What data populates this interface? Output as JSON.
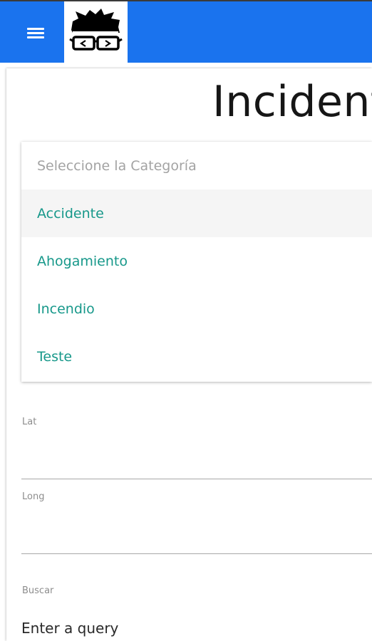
{
  "colors": {
    "appbar": "#1a73ee",
    "option_text": "#17988a",
    "placeholder_text": "#a3a3a3"
  },
  "appbar": {
    "menu_icon": "hamburger-menu-icon",
    "logo_icon": "geek-glasses-logo-icon"
  },
  "page": {
    "title": "Incident"
  },
  "category_dropdown": {
    "placeholder": "Seleccione la Categoría",
    "options": [
      "Accidente",
      "Ahogamiento",
      "Incendio",
      "Teste"
    ],
    "highlighted_option": "Accidente"
  },
  "fields": {
    "lat_label": "Lat",
    "long_label": "Long",
    "search_label": "Buscar",
    "search_placeholder": "Enter a query"
  }
}
